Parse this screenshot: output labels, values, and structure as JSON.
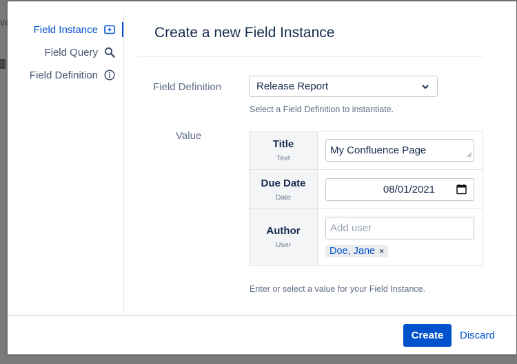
{
  "backdrop": {
    "text": "ve"
  },
  "sidebar": {
    "items": [
      {
        "label": "Field Instance",
        "icon": "add-box-icon",
        "active": true
      },
      {
        "label": "Field Query",
        "icon": "search-icon",
        "active": false
      },
      {
        "label": "Field Definition",
        "icon": "info-icon",
        "active": false
      }
    ]
  },
  "dialog": {
    "title": "Create a new Field Instance"
  },
  "form": {
    "definition_label": "Field Definition",
    "definition_value": "Release Report",
    "definition_help": "Select a Field Definition to instantiate.",
    "value_label": "Value",
    "value_help": "Enter or select a value for your Field Instance.",
    "fields": [
      {
        "name": "Title",
        "type": "Text",
        "value": "My Confluence Page"
      },
      {
        "name": "Due Date",
        "type": "Date",
        "value": "08/01/2021"
      },
      {
        "name": "Author",
        "type": "User",
        "placeholder": "Add user",
        "tag": "Doe, Jane",
        "tag_remove": "×"
      }
    ]
  },
  "footer": {
    "create_label": "Create",
    "discard_label": "Discard"
  },
  "colors": {
    "accent": "#0052cc",
    "text": "#172b4d",
    "muted": "#5e6c84"
  }
}
